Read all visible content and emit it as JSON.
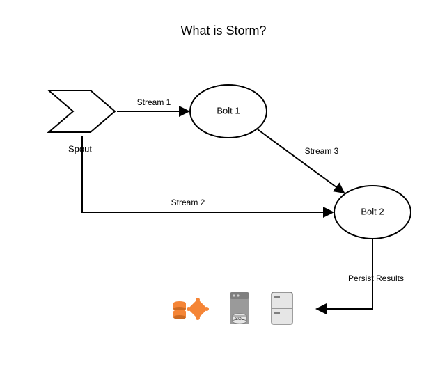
{
  "title": "What is Storm?",
  "spout": {
    "label": "Spout"
  },
  "bolt1": {
    "label": "Bolt 1"
  },
  "bolt2": {
    "label": "Bolt 2"
  },
  "edges": {
    "spout_bolt1": "Stream 1",
    "spout_bolt2": "Stream 2",
    "bolt1_bolt2": "Stream 3"
  },
  "persist_label": "Persist Results",
  "colors": {
    "title": "#000000",
    "node_stroke": "#000000",
    "node_fill": "#ffffff",
    "edge": "#000000",
    "edge_label": "#000000",
    "aws_orange": "#f58536",
    "server_gray": "#7f7f7f",
    "server_light": "#e6e6e6"
  }
}
